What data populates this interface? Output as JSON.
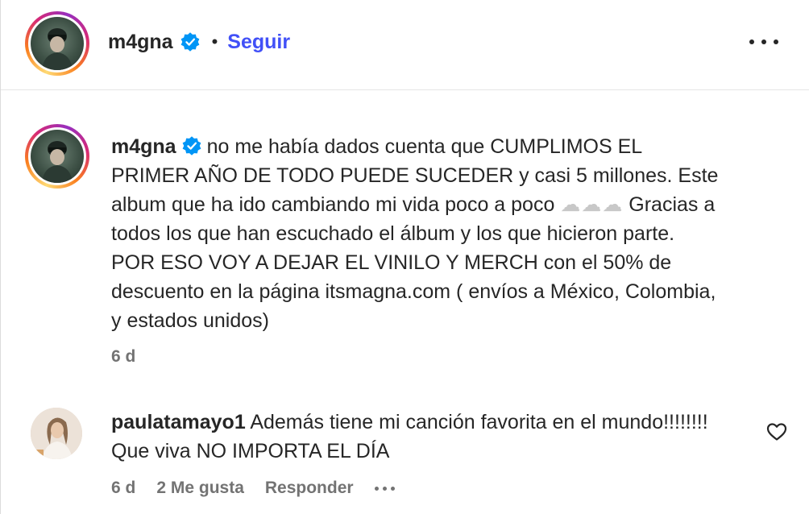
{
  "header": {
    "username": "m4gna",
    "separator": "•",
    "follow_label": "Seguir"
  },
  "caption": {
    "username": "m4gna",
    "text_before_clouds": "no me había dados cuenta que CUMPLIMOS EL PRIMER AÑO DE TODO PUEDE SUCEDER y casi 5 millones. Este album que ha ido cambiando mi vida poco a poco",
    "clouds": "☁☁☁",
    "text_after_clouds": "Gracias a todos los que han escuchado el álbum y los que hicieron parte. POR ESO VOY A DEJAR EL VINILO Y MERCH con el 50% de descuento en la página itsmagna.com ( envíos a México, Colombia, y estados unidos)",
    "time": "6 d"
  },
  "comment": {
    "username": "paulatamayo1",
    "text": "Además tiene mi canción favorita en el mundo!!!!!!!! Que viva NO IMPORTA EL DÍA",
    "time": "6 d",
    "likes_label": "2 Me gusta",
    "reply_label": "Responder"
  },
  "colors": {
    "accent": "#4150f7",
    "verified": "#0095f6",
    "text": "#262626",
    "secondary_text": "#737373"
  },
  "icons": {
    "more": "more-horizontal-icon",
    "verified": "verified-badge-icon",
    "like": "heart-outline-icon"
  }
}
